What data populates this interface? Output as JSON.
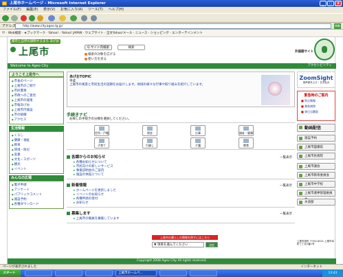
{
  "window": {
    "title": "上尾市ホームページ - Microsoft Internet Explorer"
  },
  "menu": [
    "ファイル(F)",
    "編集(E)",
    "表示(V)",
    "お気に入り(A)",
    "ツール(T)",
    "ヘルプ(H)"
  ],
  "address": {
    "label": "アドレス(D)",
    "url": "http://www.city.ageo.lg.jp/",
    "go": "移動"
  },
  "ytoolbar": "Y! · Web検索 · ★ブックマーク · Yahoo! · Yahoo! JAPAN · ウェブサイト · 全文Yahoo!メール · ニュース · ショッピング · エンターテインメント",
  "site": {
    "tagline": "都市と自然の調和するまち あげお",
    "logo": "上尾市",
    "search_btn": "Q サイト内検索",
    "search_box": "検索",
    "link1": "検索の対象を広げる",
    "link2": "使い方を見る",
    "foreign": "外国語サイト",
    "welcome": "Welcome to Ageo City",
    "welcome_r": "アクセシビリティ",
    "left": [
      {
        "head": "ようこそ上尾市へ",
        "items": [
          "市長のページ",
          "上尾市のご紹介",
          "市民憲章",
          "市政へのご意見",
          "上尾市の施策",
          "市報あげお",
          "上尾市内施設",
          "市の組織",
          "アクセス"
        ]
      },
      {
        "head": "生活情報",
        "items": [
          "くらし",
          "健康・福祉",
          "教育",
          "環境・防災",
          "産業",
          "文化・スポーツ",
          "観光",
          "イベント"
        ]
      },
      {
        "head": "みんなの広場",
        "items": [
          "電子申請",
          "アンケート",
          "パブリックコメント",
          "施設予約",
          "各種ダウンロード"
        ]
      }
    ],
    "topic": {
      "title": "あげおTOPIC",
      "date": "平成",
      "text": "上尾市の風景と市民生活の話題をお届けします。地域の様々な行事や取り組みを紹介しています。"
    },
    "nav": {
      "title": "手続きナビ",
      "desc": "お探しの手続きの分類を選択してください。",
      "buttons": [
        "住所・戸籍",
        "税金",
        "仕事",
        "福祉・健康",
        "子育て",
        "引越し",
        "介護",
        "教育"
      ]
    },
    "sections": [
      {
        "title": "各課からのお知らせ",
        "items": [
          "各種お知らせについて",
          "市民向けの新しいサービス",
          "事業説明会のご案内",
          "施設の休館について"
        ],
        "more": "一覧表示"
      },
      {
        "title": "新着情報",
        "items": [
          "ホームページを更新しました",
          "イベントのお知らせ",
          "各種申請の受付",
          "お知らせ"
        ],
        "more": "一覧表示"
      },
      {
        "title": "募集します",
        "items": [
          "上尾市の職員を募集しています"
        ],
        "more": "一覧表示"
      }
    ],
    "redbar": "上尾市の暮らしの情報を探すにはこちら",
    "select": "▼ 項目を選んでください",
    "select_go": "決定",
    "right": {
      "zoom": "ZoomSight",
      "zoom_sub": "音声読み上げ・文字拡大",
      "emerg": "緊急時のご案内",
      "emerg_items": [
        "防災情報",
        "救急病院",
        "休日当番医"
      ],
      "btn_big": "動画配信",
      "btns": [
        "施設予約",
        "上尾市図書館",
        "上尾市民病院",
        "上尾市議会",
        "上尾市教育委員会",
        "上尾市中学校",
        "上尾市選挙管理委員会",
        "水道部"
      ],
      "addr": "上尾市役所 〒362-8501 上尾市本町三丁目1番1号"
    },
    "footer": "Copyright 2008 Ageo City All rights reserved."
  },
  "status": {
    "left": "ページが表示されました",
    "right": "インターネット"
  },
  "taskbar": {
    "start": "スタート",
    "items": [
      "上尾市ホームペ...",
      "",
      "",
      "",
      "",
      ""
    ],
    "clock": "13:43"
  }
}
